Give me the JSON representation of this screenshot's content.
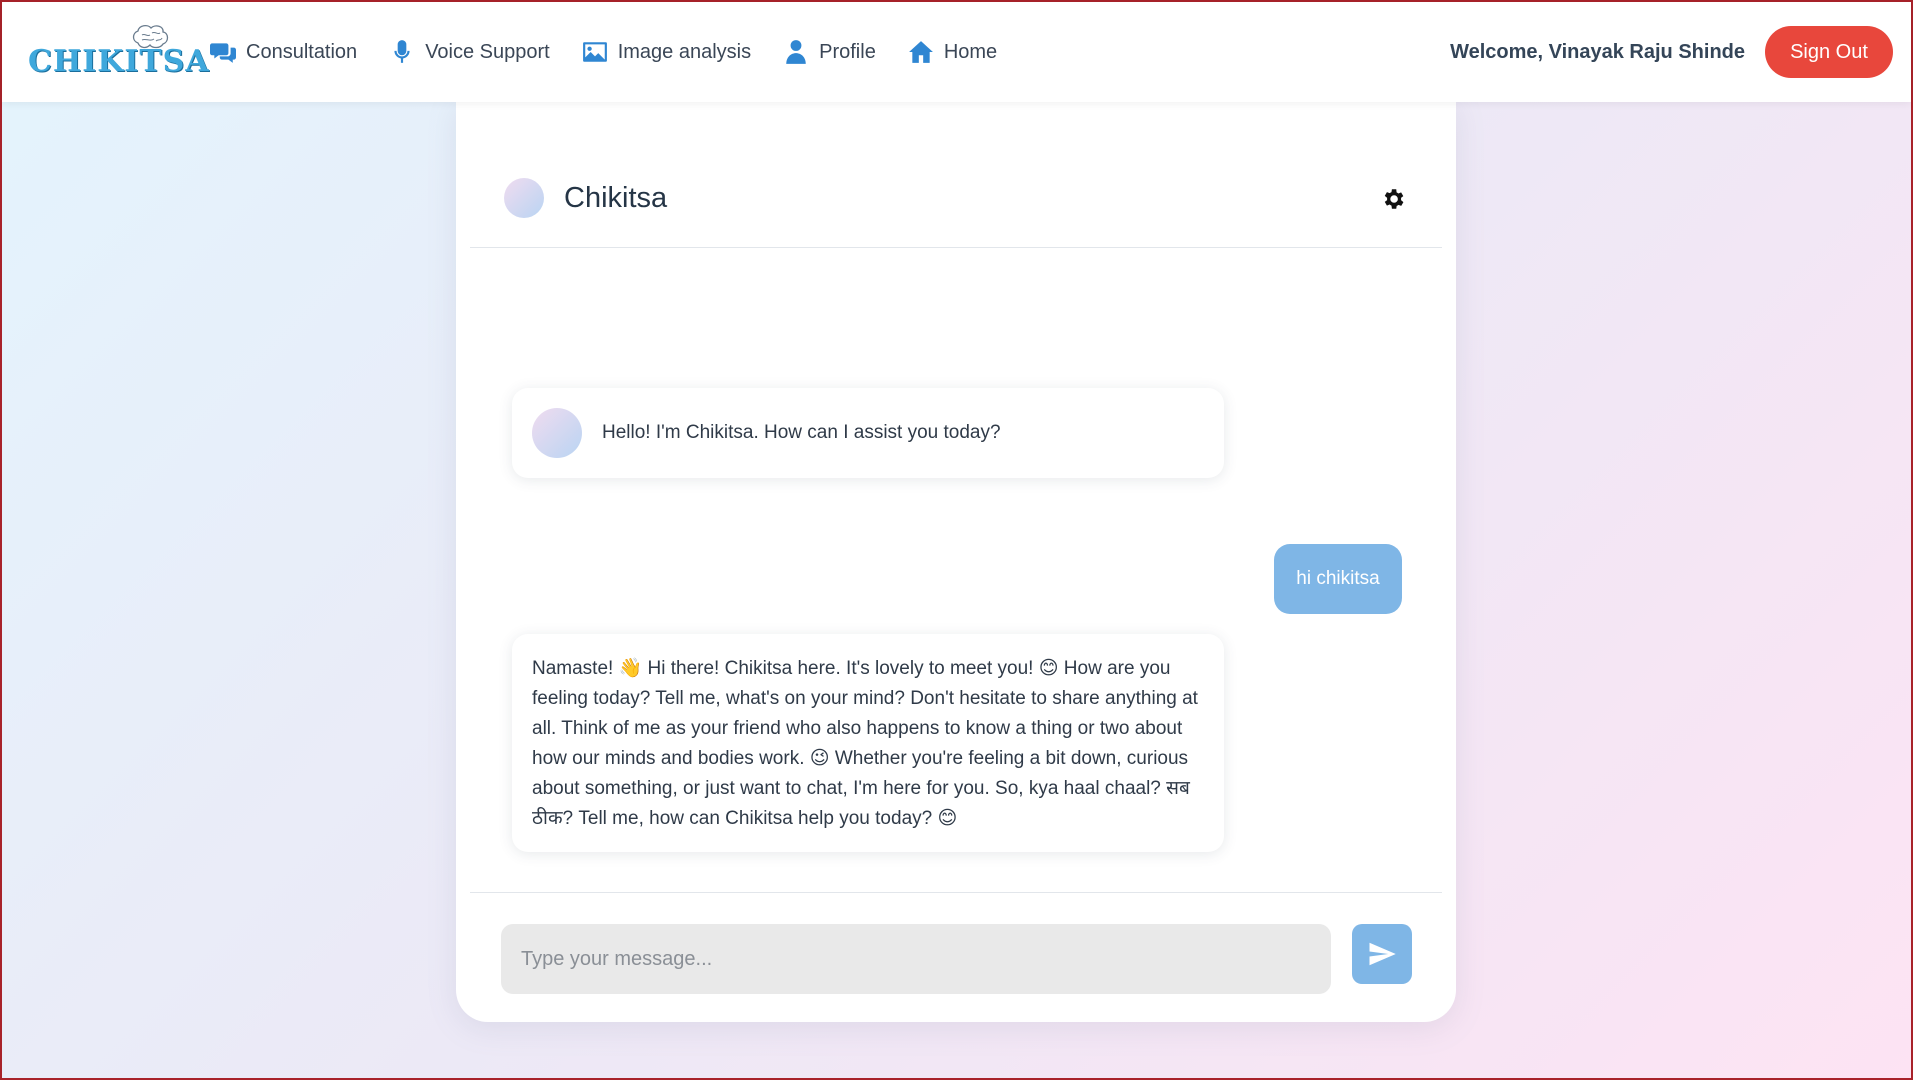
{
  "navbar": {
    "logo_text": "CHIKITSA",
    "links": [
      {
        "label": "Consultation",
        "icon": "chat-bubbles-icon"
      },
      {
        "label": "Voice Support",
        "icon": "microphone-icon"
      },
      {
        "label": "Image analysis",
        "icon": "image-icon"
      },
      {
        "label": "Profile",
        "icon": "user-icon"
      },
      {
        "label": "Home",
        "icon": "home-icon"
      }
    ],
    "welcome_text": "Welcome, Vinayak Raju Shinde",
    "signout_label": "Sign Out"
  },
  "chat": {
    "title": "Chikitsa",
    "messages": [
      {
        "sender": "bot",
        "text": "Hello! I'm Chikitsa. How can I assist you today?"
      },
      {
        "sender": "user",
        "text": "hi chikitsa"
      },
      {
        "sender": "bot",
        "text": "Namaste! 👋 Hi there! Chikitsa here. It's lovely to meet you! 😊 How are you feeling today? Tell me, what's on your mind? Don't hesitate to share anything at all. Think of me as your friend who also happens to know a thing or two about how our minds and bodies work. 😉 Whether you're feeling a bit down, curious about something, or just want to chat, I'm here for you. So, kya haal chaal? सब ठीक? Tell me, how can Chikitsa help you today? 😊"
      }
    ],
    "input_placeholder": "Type your message..."
  },
  "colors": {
    "accent": "#2f86d2",
    "signout": "#e8473c",
    "user_bubble": "#7fb6e6"
  }
}
